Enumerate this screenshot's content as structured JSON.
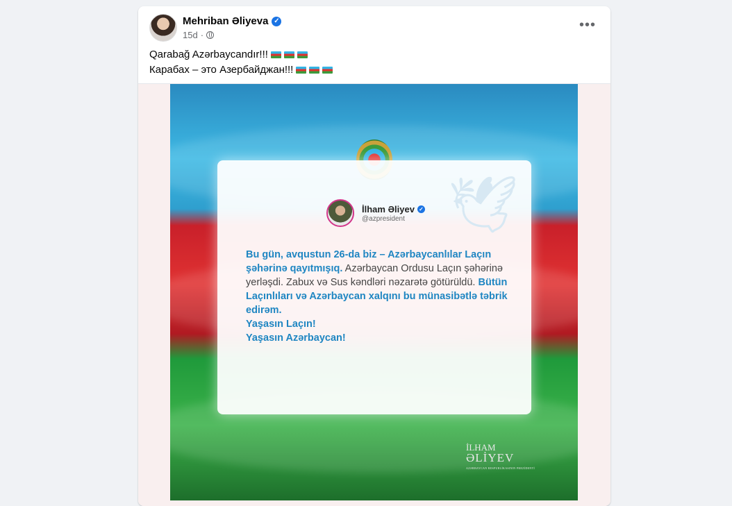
{
  "post": {
    "author": "Mehriban Əliyeva",
    "time": "15d",
    "line1": "Qarabağ Azərbaycandır!!!",
    "line2": "Карабах – это Азербайджан!!!",
    "flag_color_top": "#34b3e4",
    "flag_color_mid": "#e0312f",
    "flag_color_bottom": "#3c9b3c"
  },
  "icons": {
    "verified": "verified-badge-icon",
    "privacy": "globe-icon",
    "more": "more-options-icon"
  },
  "image": {
    "tweet_author": "İlham Əliyev",
    "tweet_handle": "@azpresident",
    "tweet_p1": "Bu gün, avqustun 26-da biz – Azərbaycanlılar Laçın şəhərinə qayıtmışıq.",
    "tweet_p2": " Azərbaycan Ordusu Laçın şəhərinə yerləşdi. Zabux və Sus kəndləri nəzarətə götürüldü. ",
    "tweet_p3": "Bütün Laçınlıları və Azərbaycan xalqını bu münasibətlə təbrik edirəm.",
    "tweet_p4": "Yaşasın Laçın!",
    "tweet_p5": "Yaşasın Azərbaycan!",
    "sig_line1": "İLHAM",
    "sig_line2": "ƏLİYEV",
    "sig_line3": "AZƏRBAYCAN RESPUBLİKASININ PREZİDENTİ"
  }
}
